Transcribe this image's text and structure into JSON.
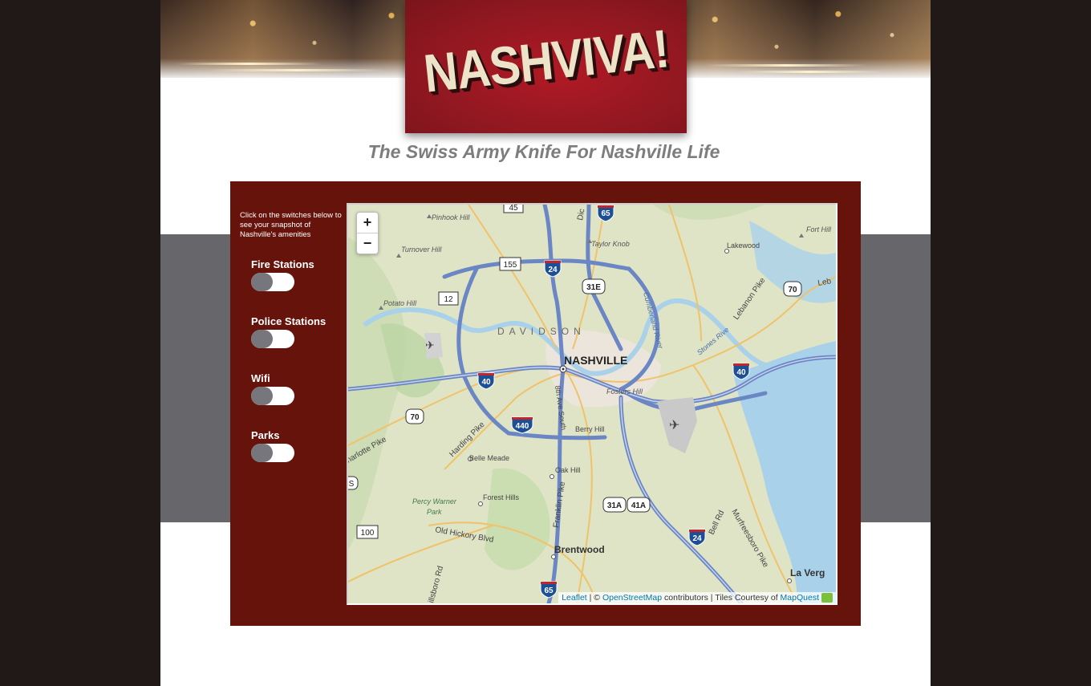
{
  "header": {
    "logo_text": "NASHVIVA!",
    "tagline": "The Swiss Army Knife For Nashville Life"
  },
  "sidebar": {
    "instructions": "Click on the switches below to see your snapshot of Nashville's amenities",
    "toggles": [
      {
        "label": "Fire Stations",
        "state": "off"
      },
      {
        "label": "Police Stations",
        "state": "off"
      },
      {
        "label": "Wifi",
        "state": "off"
      },
      {
        "label": "Parks",
        "state": "off"
      }
    ]
  },
  "map": {
    "zoom_in": "+",
    "zoom_out": "−",
    "attribution": {
      "leaflet": "Leaflet",
      "sep1": " | © ",
      "osm": "OpenStreetMap",
      "middle": " contributors | Tiles Courtesy of ",
      "mapquest": "MapQuest"
    },
    "labels": {
      "city": "NASHVILLE",
      "county": "DAVIDSON",
      "brentwood": "Brentwood",
      "belle_meade": "Belle Meade",
      "forest_hills": "Forest Hills",
      "oak_hill": "Oak Hill",
      "berry_hill": "Berry Hill",
      "fosters_hill": "Fosters Hill",
      "lakewood": "Lakewood",
      "la_vergne": "La Verg",
      "pinhook_hill": "Pinhook Hill",
      "turnover_hill": "Turnover Hill",
      "taylor_knob": "Taylor Knob",
      "potato_hill": "Potato Hill",
      "fort_hill": "Fort Hill",
      "percy_warner_park_1": "Percy Warner",
      "percy_warner_park_2": "Park",
      "harding_pike": "Harding Pike",
      "charlotte_pike": "harlotte Pike",
      "old_hickory_blvd": "Old Hickory Blvd",
      "franklin_pike": "Franklin Pike",
      "eighth_ave_south": "8th Ave South",
      "lebanon_pike": "Lebanon Pike",
      "bell_rd": "Bell Rd",
      "murfreesboro_pike": "Murfreesboro Pike",
      "cumberland_river": "Cumberland River",
      "stones_river": "Stones Rive",
      "hillsboro_rd": "illsboro Rd",
      "leb": "Leb",
      "dic": "Dic"
    },
    "shields": {
      "i65": "65",
      "i24a": "24",
      "i40a": "40",
      "i40b": "40",
      "i440": "440",
      "i24b": "24",
      "i65b": "65",
      "us31e": "31E",
      "us70a": "70",
      "us70b": "70",
      "us31a": "31A",
      "us41a": "41A",
      "sr155": "155",
      "sr12": "12",
      "sr100": "100",
      "sr45": "45",
      "s_edge": "S"
    }
  }
}
